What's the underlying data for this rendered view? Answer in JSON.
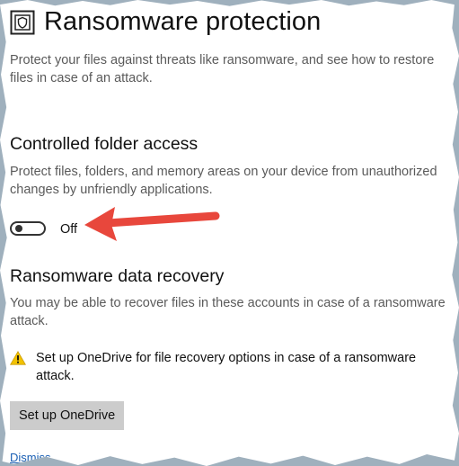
{
  "page": {
    "title": "Ransomware protection",
    "title_icon": "ransomware-shield-icon",
    "description": "Protect your files against threats like ransomware, and see how to restore files in case of an attack."
  },
  "controlled_folder_access": {
    "heading": "Controlled folder access",
    "description": "Protect files, folders, and memory areas on your device from unauthorized changes by unfriendly applications.",
    "toggle_state": "Off",
    "toggle_on": false
  },
  "data_recovery": {
    "heading": "Ransomware data recovery",
    "description": "You may be able to recover files in these accounts in case of a ransomware attack.",
    "warning_icon": "warning-icon",
    "warning_text": "Set up OneDrive for file recovery options in case of a ransomware attack.",
    "setup_button": "Set up OneDrive",
    "dismiss_link": "Dismiss"
  },
  "annotation": {
    "arrow_color": "#e8473c",
    "points_to": "controlled-folder-access-toggle"
  },
  "colors": {
    "background": "#ffffff",
    "border": "#9fb0bd",
    "secondary_text": "#5a5a5a",
    "button_bg": "#cccccc",
    "warning_yellow": "#f2c200",
    "link": "#1a5fb4"
  }
}
